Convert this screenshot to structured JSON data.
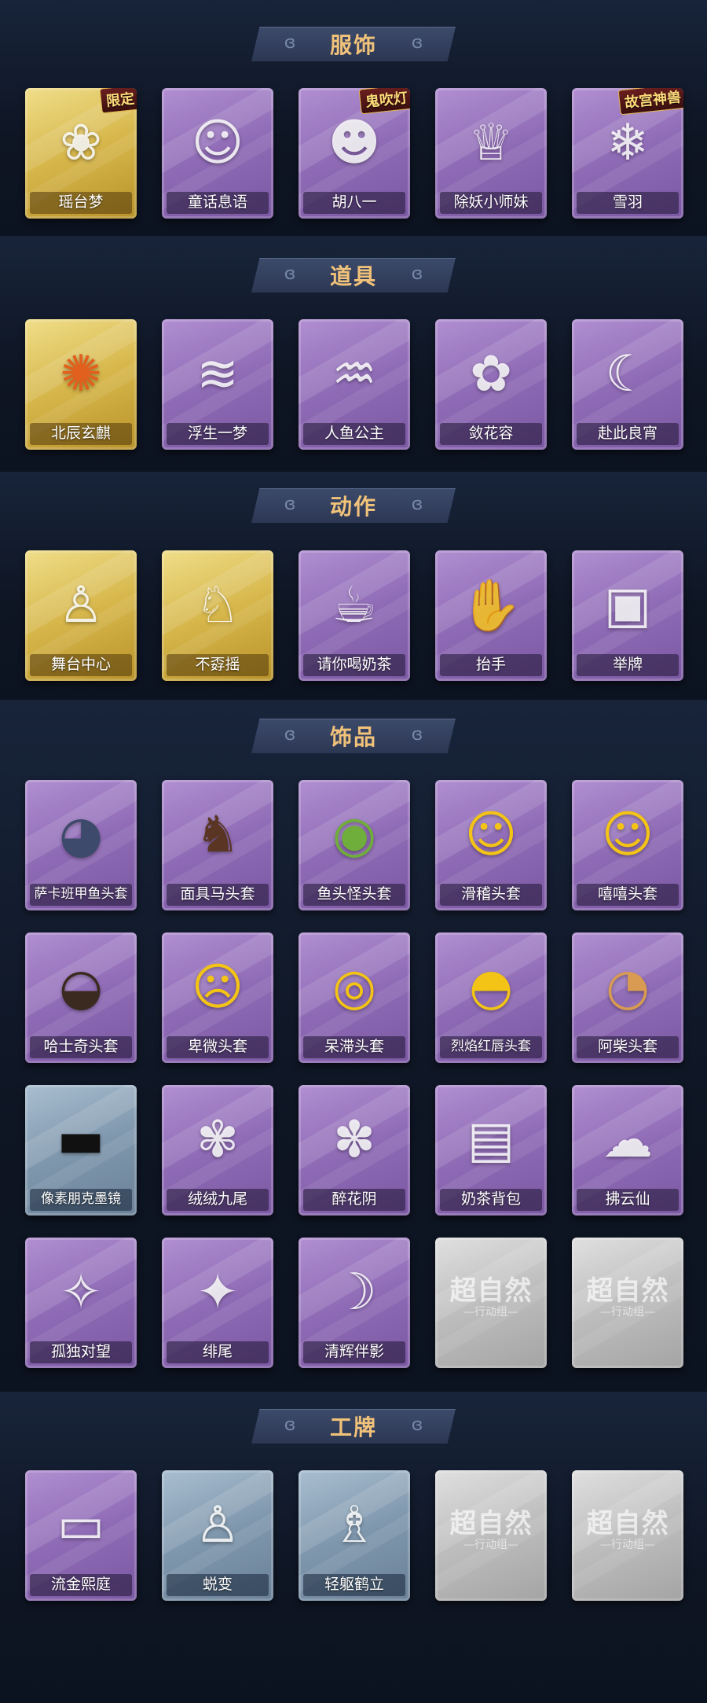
{
  "sections": [
    {
      "title": "服饰",
      "items": [
        {
          "label": "瑶台梦",
          "rarity": "gold",
          "badge": "限定",
          "icon": "costume-figure-icon"
        },
        {
          "label": "童话息语",
          "rarity": "purple",
          "icon": "costume-girl-icon"
        },
        {
          "label": "胡八一",
          "rarity": "purple",
          "badge": "鬼吹灯",
          "icon": "costume-boy-icon"
        },
        {
          "label": "除妖小师妹",
          "rarity": "purple",
          "icon": "costume-blindfold-icon"
        },
        {
          "label": "雪羽",
          "rarity": "purple",
          "badge": "故宫神兽",
          "icon": "costume-white-hair-icon"
        }
      ]
    },
    {
      "title": "道具",
      "items": [
        {
          "label": "北辰玄麒",
          "rarity": "gold",
          "icon": "flame-prop-icon"
        },
        {
          "label": "浮生一梦",
          "rarity": "purple",
          "icon": "scroll-prop-icon"
        },
        {
          "label": "人鱼公主",
          "rarity": "purple",
          "icon": "mermaid-prop-icon"
        },
        {
          "label": "敛花容",
          "rarity": "purple",
          "icon": "hairpin-prop-icon"
        },
        {
          "label": "赴此良宵",
          "rarity": "purple",
          "icon": "moon-lantern-icon"
        }
      ]
    },
    {
      "title": "动作",
      "items": [
        {
          "label": "舞台中心",
          "rarity": "gold",
          "icon": "pose-center-icon"
        },
        {
          "label": "不孬摇",
          "rarity": "gold",
          "icon": "pose-dance-icon"
        },
        {
          "label": "请你喝奶茶",
          "rarity": "purple",
          "icon": "pose-tea-icon"
        },
        {
          "label": "抬手",
          "rarity": "purple",
          "icon": "pose-raise-hand-icon"
        },
        {
          "label": "举牌",
          "rarity": "purple",
          "icon": "pose-sign-icon"
        }
      ]
    },
    {
      "title": "饰品",
      "items": [
        {
          "label": "萨卡班甲鱼头套",
          "rarity": "purple",
          "icon": "fish-head-icon"
        },
        {
          "label": "面具马头套",
          "rarity": "purple",
          "icon": "horse-head-icon"
        },
        {
          "label": "鱼头怪头套",
          "rarity": "purple",
          "icon": "green-fish-head-icon"
        },
        {
          "label": "滑稽头套",
          "rarity": "purple",
          "icon": "funny-face-icon"
        },
        {
          "label": "嘻嘻头套",
          "rarity": "purple",
          "icon": "grin-face-icon"
        },
        {
          "label": "哈士奇头套",
          "rarity": "purple",
          "icon": "husky-head-icon"
        },
        {
          "label": "卑微头套",
          "rarity": "purple",
          "icon": "humble-face-icon"
        },
        {
          "label": "呆滞头套",
          "rarity": "purple",
          "icon": "dazed-face-icon"
        },
        {
          "label": "烈焰红唇头套",
          "rarity": "purple",
          "icon": "red-lips-head-icon"
        },
        {
          "label": "阿柴头套",
          "rarity": "purple",
          "icon": "shiba-head-icon"
        },
        {
          "label": "像素朋克墨镜",
          "rarity": "blue",
          "icon": "pixel-sunglasses-icon"
        },
        {
          "label": "绒绒九尾",
          "rarity": "purple",
          "icon": "nine-tail-fox-icon"
        },
        {
          "label": "醉花阴",
          "rarity": "purple",
          "icon": "flower-ornament-icon"
        },
        {
          "label": "奶茶背包",
          "rarity": "purple",
          "icon": "tea-backpack-icon"
        },
        {
          "label": "拂云仙",
          "rarity": "purple",
          "icon": "cloud-charm-icon"
        },
        {
          "label": "孤独对望",
          "rarity": "purple",
          "icon": "charm-girl-icon"
        },
        {
          "label": "绯尾",
          "rarity": "purple",
          "icon": "charm-fox-icon"
        },
        {
          "label": "清辉伴影",
          "rarity": "purple",
          "icon": "charm-moon-icon"
        },
        {
          "label": "",
          "rarity": "gray",
          "watermark": "超自然",
          "watermark_sub": "—行动组—",
          "icon": "placeholder-logo-icon"
        },
        {
          "label": "",
          "rarity": "gray",
          "watermark": "超自然",
          "watermark_sub": "—行动组—",
          "icon": "placeholder-logo-icon"
        }
      ]
    },
    {
      "title": "工牌",
      "items": [
        {
          "label": "流金熙庭",
          "rarity": "purple",
          "icon": "badge-card-gold-icon"
        },
        {
          "label": "蜕变",
          "rarity": "blue",
          "icon": "badge-card-silhouette-icon"
        },
        {
          "label": "轻躯鹤立",
          "rarity": "blue",
          "icon": "badge-card-pose-icon"
        },
        {
          "label": "",
          "rarity": "gray",
          "watermark": "超自然",
          "watermark_sub": "—行动组—",
          "icon": "placeholder-logo-icon"
        },
        {
          "label": "",
          "rarity": "gray",
          "watermark": "超自然",
          "watermark_sub": "—行动组—",
          "icon": "placeholder-logo-icon"
        }
      ]
    }
  ],
  "colors": {
    "background": "#111826",
    "title": "#f1c27a",
    "purple": "#8f6bb6",
    "gold": "#d6b64a",
    "blue": "#7f97ad",
    "gray": "#bdbdbd"
  }
}
